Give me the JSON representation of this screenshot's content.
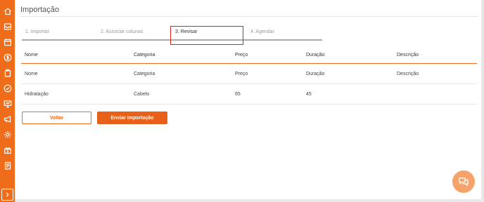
{
  "colors": {
    "accent": "#ee6c1a",
    "highlight_box": "#e0201b",
    "chat_fab": "#f5a36a"
  },
  "sidebar": {
    "items": [
      {
        "icon": "home-icon"
      },
      {
        "icon": "inbox-icon"
      },
      {
        "icon": "calendar-icon"
      },
      {
        "icon": "dollar-icon"
      },
      {
        "icon": "clipboard-icon"
      },
      {
        "icon": "check-circle-icon"
      },
      {
        "icon": "presentation-chart-icon"
      },
      {
        "icon": "megaphone-icon"
      },
      {
        "icon": "gear-icon"
      },
      {
        "icon": "gift-icon"
      },
      {
        "icon": "report-icon"
      }
    ],
    "toggle_icon": "chevron-right-icon"
  },
  "page": {
    "title": "Importação"
  },
  "steps": [
    {
      "label": "1. Importar"
    },
    {
      "label": "2. Associar colunas"
    },
    {
      "label": "3. Revisar"
    },
    {
      "label": "4. Agendar"
    }
  ],
  "table": {
    "headers": [
      "Nome",
      "Categoria",
      "Preço",
      "Duração",
      "Descrição"
    ],
    "rows": [
      [
        "Nome",
        "Categoria",
        "Preço",
        "Duração",
        "Descrição"
      ],
      [
        "Hidratação",
        "Cabelo",
        "65",
        "45",
        ""
      ]
    ]
  },
  "actions": {
    "back_label": "Voltar",
    "submit_label": "Enviar importação"
  },
  "chat": {
    "icon": "chat-icon"
  }
}
